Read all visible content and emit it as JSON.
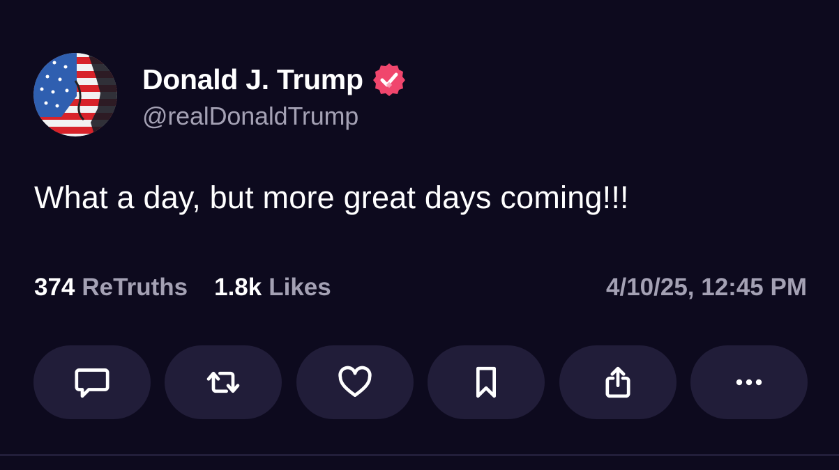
{
  "author": {
    "display_name": "Donald J. Trump",
    "handle": "@realDonaldTrump",
    "verified": true,
    "verified_color": "#f0466d"
  },
  "post": {
    "text": "What a day, but more great days coming!!!",
    "timestamp": "4/10/25, 12:45 PM"
  },
  "stats": {
    "retruths_count": "374",
    "retruths_label": "ReTruths",
    "likes_count": "1.8k",
    "likes_label": "Likes"
  },
  "actions": [
    {
      "name": "reply",
      "icon": "speech-bubble-icon"
    },
    {
      "name": "retruth",
      "icon": "repost-arrows-icon"
    },
    {
      "name": "like",
      "icon": "heart-icon"
    },
    {
      "name": "bookmark",
      "icon": "bookmark-icon"
    },
    {
      "name": "share",
      "icon": "share-icon"
    },
    {
      "name": "more",
      "icon": "more-dots-icon"
    }
  ],
  "colors": {
    "background": "#0d0a1e",
    "button_bg": "#211d39",
    "muted_text": "#a4a1b4",
    "accent": "#f0466d"
  }
}
